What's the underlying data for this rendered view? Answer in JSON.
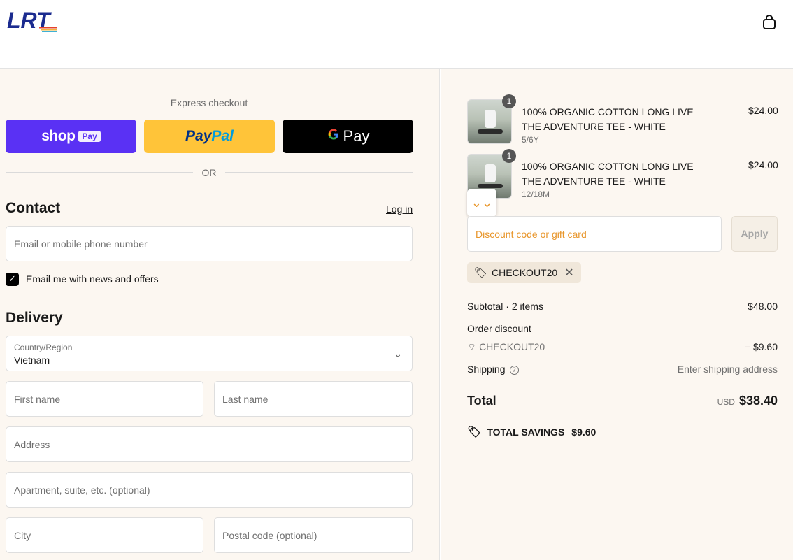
{
  "header": {
    "logo_text": "LRT",
    "colors": {
      "logo_blue": "#1b2b8f",
      "logo_stripes": [
        "#e4432d",
        "#f2b43a",
        "#3fb1d6"
      ]
    }
  },
  "express": {
    "label": "Express checkout",
    "shop": {
      "word": "shop",
      "pay": "Pay"
    },
    "paypal": {
      "pay": "Pay",
      "pal": "Pal"
    },
    "gpay": {
      "g": "G",
      "word": "Pay"
    },
    "or": "OR",
    "colors": {
      "shop": "#5a31f4",
      "paypal": "#ffc439",
      "gpay": "#000000"
    }
  },
  "contact": {
    "title": "Contact",
    "login": "Log in",
    "email_placeholder": "Email or mobile phone number",
    "newsletter_label": "Email me with news and offers",
    "newsletter_checked": true
  },
  "delivery": {
    "title": "Delivery",
    "country_label": "Country/Region",
    "country_value": "Vietnam",
    "first_name": "First name",
    "last_name": "Last name",
    "address": "Address",
    "apartment": "Apartment, suite, etc. (optional)",
    "city": "City",
    "postal": "Postal code (optional)"
  },
  "summary": {
    "items": [
      {
        "name": "100% ORGANIC COTTON LONG LIVE THE ADVENTURE TEE - WHITE",
        "variant": "5/6Y",
        "price": "$24.00",
        "qty": "1"
      },
      {
        "name": "100% ORGANIC COTTON LONG LIVE THE ADVENTURE TEE - WHITE",
        "variant": "12/18M",
        "price": "$24.00",
        "qty": "1"
      }
    ],
    "discount_placeholder": "Discount code or gift card",
    "apply": "Apply",
    "applied_code": "CHECKOUT20",
    "subtotal_label": "Subtotal · 2 items",
    "subtotal_value": "$48.00",
    "order_discount_label": "Order discount",
    "order_discount_code": "CHECKOUT20",
    "order_discount_value": "− $9.60",
    "shipping_label": "Shipping",
    "shipping_value": "Enter shipping address",
    "total_label": "Total",
    "total_currency": "USD",
    "total_value": "$38.40",
    "savings_label": "TOTAL SAVINGS",
    "savings_value": "$9.60",
    "accent": "#e8962b"
  }
}
